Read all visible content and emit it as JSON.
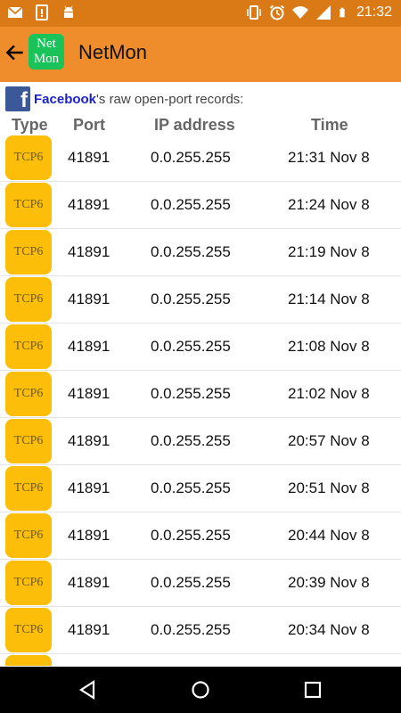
{
  "status_bar": {
    "time": "21:32",
    "left_icons": [
      "mail-icon",
      "tablet-icon",
      "android-icon"
    ],
    "right_icons": [
      "vibrate-icon",
      "alarm-icon",
      "wifi-icon",
      "signal-icon",
      "battery-icon"
    ]
  },
  "app_bar": {
    "title": "NetMon",
    "logo_line1": "Net",
    "logo_line2": "Mon",
    "bg_color": "#ef8d2d"
  },
  "intro": {
    "app_name": "Facebook",
    "suffix": "'s raw open-port records:",
    "fb_glyph": "f"
  },
  "table": {
    "headers": [
      "Type",
      "Port",
      "IP address",
      "Time"
    ],
    "rows": [
      {
        "type": "TCP6",
        "port": "41891",
        "ip": "0.0.255.255",
        "time": "21:31 Nov 8"
      },
      {
        "type": "TCP6",
        "port": "41891",
        "ip": "0.0.255.255",
        "time": "21:24 Nov 8"
      },
      {
        "type": "TCP6",
        "port": "41891",
        "ip": "0.0.255.255",
        "time": "21:19 Nov 8"
      },
      {
        "type": "TCP6",
        "port": "41891",
        "ip": "0.0.255.255",
        "time": "21:14 Nov 8"
      },
      {
        "type": "TCP6",
        "port": "41891",
        "ip": "0.0.255.255",
        "time": "21:08 Nov 8"
      },
      {
        "type": "TCP6",
        "port": "41891",
        "ip": "0.0.255.255",
        "time": "21:02 Nov 8"
      },
      {
        "type": "TCP6",
        "port": "41891",
        "ip": "0.0.255.255",
        "time": "20:57 Nov 8"
      },
      {
        "type": "TCP6",
        "port": "41891",
        "ip": "0.0.255.255",
        "time": "20:51 Nov 8"
      },
      {
        "type": "TCP6",
        "port": "41891",
        "ip": "0.0.255.255",
        "time": "20:44 Nov 8"
      },
      {
        "type": "TCP6",
        "port": "41891",
        "ip": "0.0.255.255",
        "time": "20:39 Nov 8"
      },
      {
        "type": "TCP6",
        "port": "41891",
        "ip": "0.0.255.255",
        "time": "20:34 Nov 8"
      },
      {
        "type": "",
        "port": "",
        "ip": "",
        "time": ""
      }
    ],
    "badge_color": "#fdbe0a"
  },
  "nav_bar": {
    "icons": [
      "back-triangle-icon",
      "home-circle-icon",
      "recents-square-icon"
    ]
  }
}
